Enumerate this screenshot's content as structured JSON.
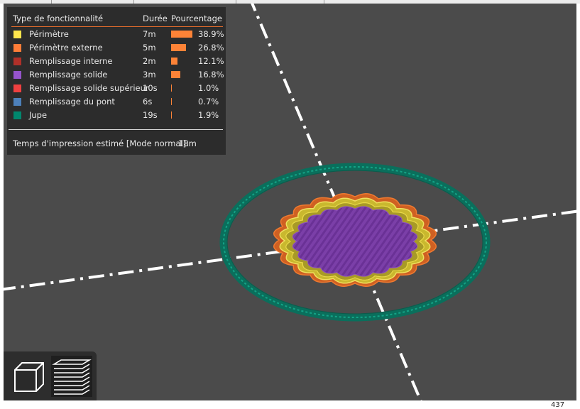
{
  "legend": {
    "headers": {
      "feature": "Type de fonctionnalité",
      "time": "Durée",
      "percent": "Pourcentage"
    },
    "items": [
      {
        "name": "Périmètre",
        "time": "7m",
        "percent": "38.9%",
        "value": 38.9,
        "color": "#ffe64d"
      },
      {
        "name": "Périmètre externe",
        "time": "5m",
        "percent": "26.8%",
        "value": 26.8,
        "color": "#ff7d38"
      },
      {
        "name": "Remplissage interne",
        "time": "2m",
        "percent": "12.1%",
        "value": 12.1,
        "color": "#b03029"
      },
      {
        "name": "Remplissage solide",
        "time": "3m",
        "percent": "16.8%",
        "value": 16.8,
        "color": "#9654cc"
      },
      {
        "name": "Remplissage solide supérieur",
        "time": "10s",
        "percent": "1.0%",
        "value": 1.0,
        "color": "#f04040"
      },
      {
        "name": "Remplissage du pont",
        "time": "6s",
        "percent": "0.7%",
        "value": 0.7,
        "color": "#4d80ba"
      },
      {
        "name": "Jupe",
        "time": "19s",
        "percent": "1.9%",
        "value": 1.9,
        "color": "#00876e"
      }
    ],
    "estimate_label": "Temps d'impression estimé [Mode normal]:",
    "estimate_value": "18m"
  },
  "view_buttons": [
    {
      "icon": "cube-icon",
      "active": false
    },
    {
      "icon": "layers-icon",
      "active": true
    }
  ],
  "coordinate_readout": "437",
  "colors": {
    "background": "#4b4b4b",
    "skirt": "#00876e",
    "outer_perimeter": "#e0651f",
    "perimeter": "#e3d43a",
    "solid_infill": "#7a3fa6",
    "axis": "#ffffff"
  }
}
